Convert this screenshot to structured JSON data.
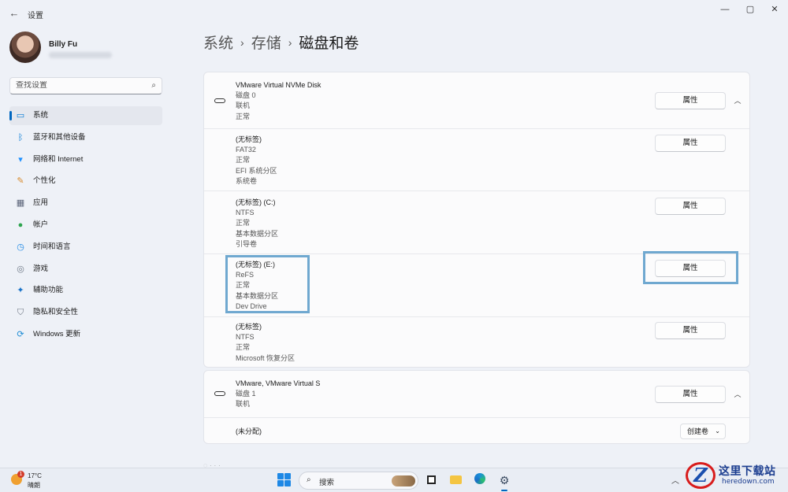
{
  "window": {
    "title": "设置",
    "back_icon": "←",
    "minimize_icon": "—",
    "maximize_icon": "▢",
    "close_icon": "✕"
  },
  "user": {
    "name": "Billy Fu"
  },
  "search": {
    "placeholder": "查找设置",
    "icon": "⌕"
  },
  "sidebar": {
    "items": [
      {
        "label": "系统",
        "icon": "▭",
        "icon_color": "#0078d4"
      },
      {
        "label": "蓝牙和其他设备",
        "icon": "ᛒ",
        "icon_color": "#0078d4"
      },
      {
        "label": "网络和 Internet",
        "icon": "▾",
        "icon_color": "#1e90ff"
      },
      {
        "label": "个性化",
        "icon": "✎",
        "icon_color": "#d88a2c"
      },
      {
        "label": "应用",
        "icon": "▦",
        "icon_color": "#5a6378"
      },
      {
        "label": "帐户",
        "icon": "●",
        "icon_color": "#2ea44f"
      },
      {
        "label": "时间和语言",
        "icon": "◷",
        "icon_color": "#1e88e5"
      },
      {
        "label": "游戏",
        "icon": "◎",
        "icon_color": "#707a88"
      },
      {
        "label": "辅助功能",
        "icon": "✦",
        "icon_color": "#1a73c8"
      },
      {
        "label": "隐私和安全性",
        "icon": "⛉",
        "icon_color": "#6e7684"
      },
      {
        "label": "Windows 更新",
        "icon": "⟳",
        "icon_color": "#1a8ad4"
      }
    ],
    "active_index": 0
  },
  "breadcrumb": {
    "part1": "系统",
    "part2": "存储",
    "current": "磁盘和卷",
    "separator": "›"
  },
  "disk0": {
    "header": {
      "name": "VMware Virtual NVMe Disk",
      "lines": [
        "磁盘 0",
        "联机",
        "正常"
      ],
      "button": "属性",
      "chevron": "︿"
    },
    "volumes": [
      {
        "title": "(无标签)",
        "lines": [
          "FAT32",
          "正常",
          "EFI 系统分区",
          "系统卷"
        ],
        "button": "属性"
      },
      {
        "title": "(无标签) (C:)",
        "lines": [
          "NTFS",
          "正常",
          "基本数据分区",
          "引导卷"
        ],
        "button": "属性"
      },
      {
        "title": "(无标签) (E:)",
        "lines": [
          "ReFS",
          "正常",
          "基本数据分区",
          "Dev Drive"
        ],
        "button": "属性"
      },
      {
        "title": "(无标签)",
        "lines": [
          "NTFS",
          "正常",
          "Microsoft 恢复分区"
        ],
        "button": "属性"
      }
    ]
  },
  "disk1": {
    "header": {
      "name": "VMware, VMware Virtual S",
      "lines": [
        "磁盘 1",
        "联机"
      ],
      "button": "属性",
      "chevron": "︿"
    },
    "unallocated": {
      "label": "(未分配)",
      "button": "创建卷",
      "dropdown": "⌄"
    }
  },
  "taskbar": {
    "weather_badge": "1",
    "weather_temp": "17°C",
    "weather_desc": "晴朗",
    "search_label": "搜索",
    "search_icon": "⌕",
    "tray_arrow": "︿"
  },
  "watermark": {
    "logo": "Z",
    "text": "这里下载站",
    "url": "heredown.com"
  },
  "colors": {
    "accent": "#0067c0",
    "highlight": "#6fa8d0"
  }
}
